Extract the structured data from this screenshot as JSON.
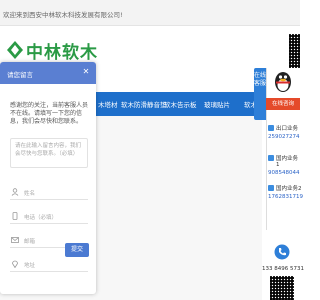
{
  "topbar": {
    "welcome": "欢迎来到西安中林软木科技发展有限公司!"
  },
  "logo": {
    "name": "中林软木"
  },
  "nav": {
    "items": [
      "木塔材",
      "软木防滑静音垫",
      "软木告示板",
      "玻璃贴片",
      "软木"
    ]
  },
  "dialog": {
    "title": "请您留言",
    "close": "✕",
    "intro": "感谢您的关注，当前客服人员不在线。请填写一下您的信息，我们会尽快和您联系。",
    "textarea_placeholder": "请在此输入留言内容，我们会尽快与您联系。（必填）",
    "fields": [
      {
        "icon": "user-icon",
        "placeholder": "姓名"
      },
      {
        "icon": "phone-icon",
        "placeholder": "电话（必填）"
      },
      {
        "icon": "mail-icon",
        "placeholder": "邮箱"
      },
      {
        "icon": "location-icon",
        "placeholder": "地址"
      }
    ],
    "submit": "提交"
  },
  "rail": {
    "online_tab": "在线客服",
    "consult": "在线咨询",
    "contacts": [
      {
        "label": "出口业务",
        "number": "259027274"
      },
      {
        "label": "国内业务1",
        "number": "908548044"
      },
      {
        "label": "国内业务2",
        "number": "1762831719"
      }
    ],
    "phone": "133 8496 5731"
  },
  "colors": {
    "nav": "#1e6fcb",
    "dialog_header": "#5a7fd2",
    "brand_green": "#2a9a45",
    "consult": "#e54a2a"
  }
}
